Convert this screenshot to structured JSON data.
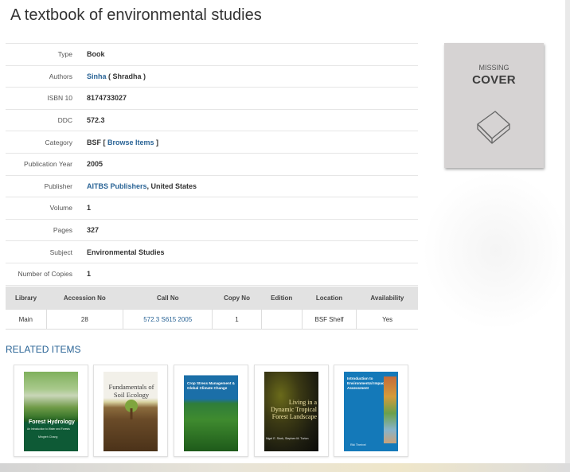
{
  "title": "A textbook of environmental studies",
  "details": {
    "type_label": "Type",
    "type_value": "Book",
    "authors_label": "Authors",
    "author_link": "Sinha",
    "author_rest": " ( Shradha )",
    "isbn_label": "ISBN 10",
    "isbn_value": "8174733027",
    "ddc_label": "DDC",
    "ddc_value": "572.3",
    "category_label": "Category",
    "category_value": "BSF",
    "category_open": " [ ",
    "browse_items": "Browse Items",
    "category_close": " ]",
    "year_label": "Publication Year",
    "year_value": "2005",
    "publisher_label": "Publisher",
    "publisher_link": "AITBS Publishers",
    "publisher_rest": ", United States",
    "volume_label": "Volume",
    "volume_value": "1",
    "pages_label": "Pages",
    "pages_value": "327",
    "subject_label": "Subject",
    "subject_value": "Environmental Studies",
    "copies_label": "Number of Copies",
    "copies_value": "1"
  },
  "cover": {
    "line1": "MISSING",
    "line2": "COVER"
  },
  "items_table": {
    "headers": [
      "Library",
      "Accession No",
      "Call No",
      "Copy No",
      "Edition",
      "Location",
      "Availability"
    ],
    "rows": [
      [
        "Main",
        "28",
        "572.3 S615 2005",
        "1",
        "",
        "BSF Shelf",
        "Yes"
      ]
    ]
  },
  "related": {
    "title": "RELATED ITEMS",
    "books": [
      {
        "title": "Forest Hydrology",
        "subtitle": "An Introduction to Water and Forests",
        "author": "Mingteh Chang"
      },
      {
        "title": "Fundamentals of Soil Ecology"
      },
      {
        "title": "Crop Stress Management & Global Climate Change"
      },
      {
        "title": "Living in a Dynamic Tropical Forest Landscape",
        "author": "Nigel E. Stork, Stephen M. Turton"
      },
      {
        "title": "Introduction to Environmental Impact Assessment",
        "author": "Riki Therivel"
      }
    ]
  },
  "colors": {
    "link": "#2a6496",
    "header_bg": "#e2e2e2",
    "cover_bg": "#d6d3d3"
  }
}
